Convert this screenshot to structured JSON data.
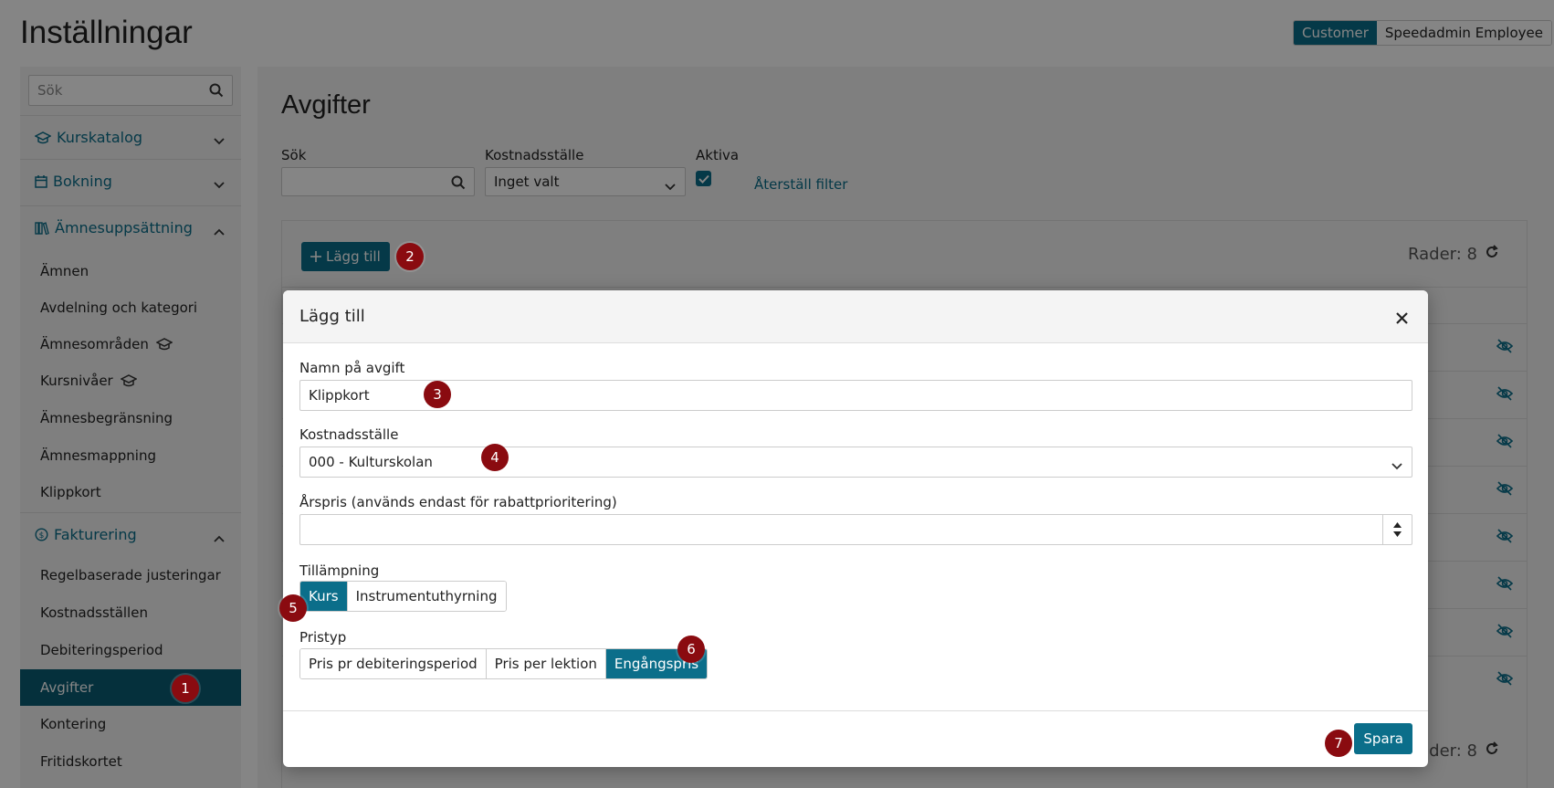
{
  "page_title": "Inställningar",
  "roles": [
    {
      "label": "Customer",
      "active": true
    },
    {
      "label": "Speedadmin Employee",
      "active": false
    }
  ],
  "sidebar": {
    "search_placeholder": "Sök",
    "sections": [
      {
        "label": "Kurskatalog",
        "icon": "graduation-cap-icon",
        "expanded": false
      },
      {
        "label": "Bokning",
        "icon": "calendar-icon",
        "expanded": false
      },
      {
        "label": "Ämnesuppsättning",
        "icon": "books-icon",
        "expanded": true
      },
      {
        "label": "Fakturering",
        "icon": "dollar-circle-icon",
        "expanded": true
      }
    ],
    "subject_items": [
      "Ämnen",
      "Avdelning och kategori",
      "Ämnesområden",
      "Kursnivåer",
      "Ämnesbegränsning",
      "Ämnesmappning",
      "Klippkort"
    ],
    "billing_items": [
      "Regelbaserade justeringar",
      "Kostnadsställen",
      "Debiteringsperiod",
      "Avgifter",
      "Kontering",
      "Fritidskortet"
    ],
    "active_item": "Avgifter"
  },
  "content": {
    "title": "Avgifter",
    "filters": {
      "search_label": "Sök",
      "cost_center_label": "Kostnadsställe",
      "cost_center_value": "Inget valt",
      "active_label": "Aktiva",
      "active_checked": true,
      "reset_label": "Återställ filter"
    },
    "add_button": "Lägg till",
    "rows_label": "Rader: 8",
    "rows_bottom_label": "Rader: 8"
  },
  "modal": {
    "title": "Lägg till",
    "name_label": "Namn på avgift",
    "name_value": "Klippkort",
    "cost_center_label": "Kostnadsställe",
    "cost_center_value": "000 - Kulturskolan",
    "annual_price_label": "Årspris (används endast för rabattprioritering)",
    "annual_price_value": "",
    "application_label": "Tillämpning",
    "application_options": [
      "Kurs",
      "Instrumentuthyrning"
    ],
    "application_selected": "Kurs",
    "price_type_label": "Pristyp",
    "price_type_options": [
      "Pris pr debiteringsperiod",
      "Pris per lektion",
      "Engångspris"
    ],
    "price_type_selected": "Engångspris",
    "save_label": "Spara"
  },
  "badges": [
    "1",
    "2",
    "3",
    "4",
    "5",
    "6",
    "7"
  ],
  "colors": {
    "accent": "#0b6e8a",
    "active_nav": "#0b5c73",
    "badge": "#8a0b10"
  }
}
